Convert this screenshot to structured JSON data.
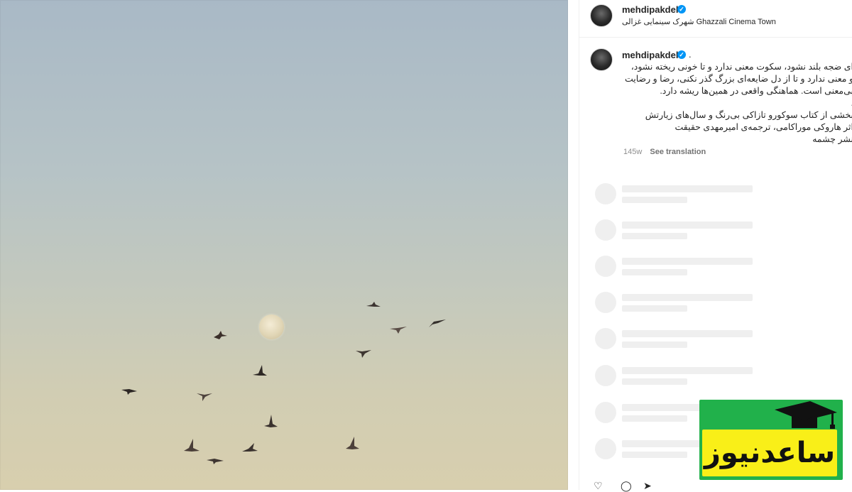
{
  "post": {
    "image_alt": "",
    "username": "mehdipakdel",
    "location": "شهرک سینمایی غزالی Ghazzali Cinema Town"
  },
  "caption": {
    "username": "mehdipakdel",
    "dot": ".",
    "text": "ای ضجه بلند نشود، سکوت معنی ندارد و تا خونی ریخته نشود،\nو معنی ندارد و تا از دل ضایعه‌ای بزرگ گذر نکنی، رضا و رضایت\nبی‌معنی است. هماهنگی واقعی در همین‌ها ریشه دارد.\n.\nبخشی از کتاب سوکورو تازاکی بی‌رنگ و سال‌های زیارتش\nاثر هاروکی موراکامی، ترجمه‌ی امیرمهدی حقیقت\nنشر چشمه",
    "time": "145w",
    "see_translation": "See translation"
  },
  "icons": {
    "verified": "verified-badge-icon",
    "heart": "heart-icon",
    "comment": "comment-icon",
    "share": "share-icon"
  },
  "watermark": {
    "text": "ساعدنیوز",
    "logo": "graduation-cap-icon"
  },
  "colors": {
    "verified_blue": "#0095f6",
    "watermark_green": "#21b14b",
    "watermark_yellow": "#f9ef18"
  }
}
